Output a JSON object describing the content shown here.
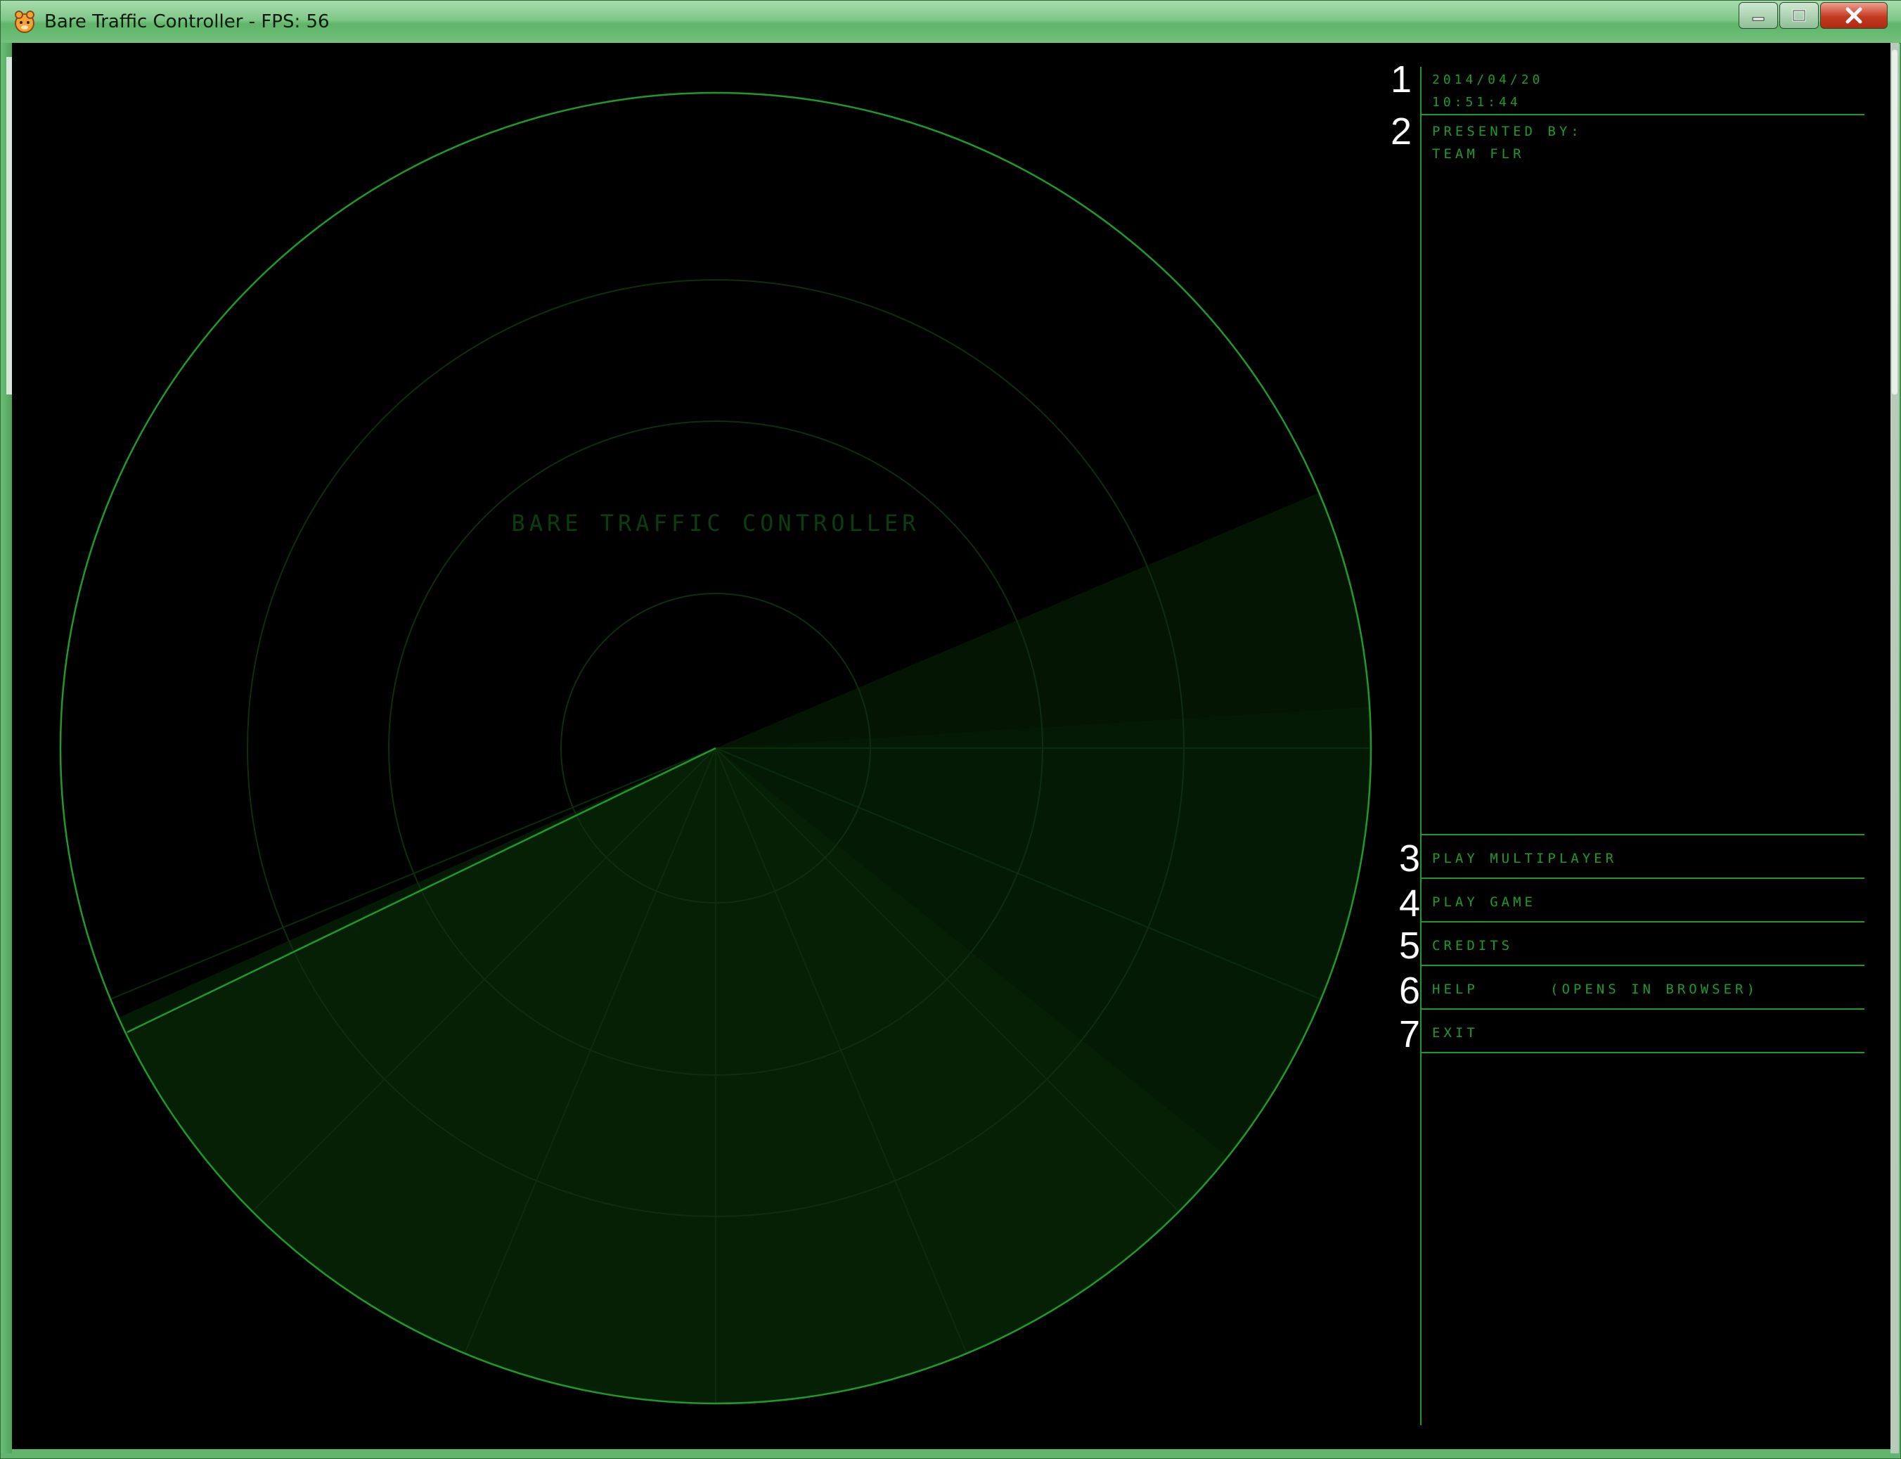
{
  "window": {
    "title": "Bare Traffic Controller - FPS: 56",
    "controls": {
      "minimize": "minimize",
      "maximize": "maximize",
      "close": "close"
    }
  },
  "game": {
    "title": "BARE TRAFFIC CONTROLLER",
    "date": "2014/04/20",
    "time": "10:51:44",
    "presented_by": "PRESENTED BY:",
    "team": "TEAM FLR",
    "menu": [
      {
        "number": "3",
        "label": "PLAY MULTIPLAYER",
        "note": ""
      },
      {
        "number": "4",
        "label": "PLAY GAME",
        "note": ""
      },
      {
        "number": "5",
        "label": "CREDITS",
        "note": ""
      },
      {
        "number": "6",
        "label": "HELP",
        "note": "(OPENS IN BROWSER)"
      },
      {
        "number": "7",
        "label": "EXIT",
        "note": ""
      }
    ],
    "markers": [
      "1",
      "2"
    ],
    "colors": {
      "radar_line": "#1f9a2a",
      "radar_faint": "#0f3a12",
      "sweep": "#0c3a0f",
      "menu_text": "#1f9a2a",
      "title_text": "#0b3d0f",
      "marker_text": "#ffffff"
    }
  }
}
